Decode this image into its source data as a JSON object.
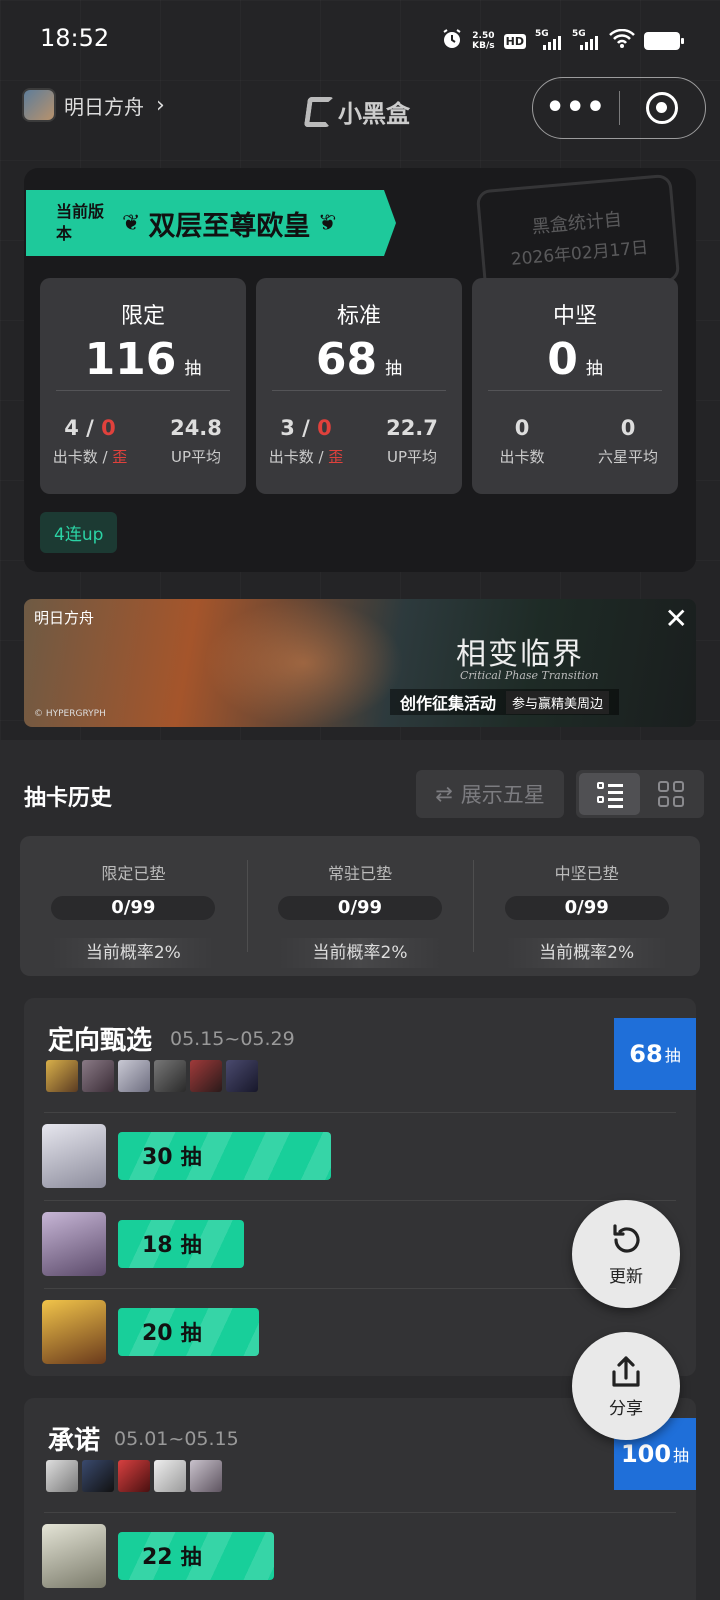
{
  "status_bar": {
    "time": "18:52",
    "speed_value": "2.50",
    "speed_unit": "KB/s",
    "hd": "HD",
    "net1": "5G",
    "net2": "5G"
  },
  "header": {
    "app_name": "明日方舟",
    "logo_text": "小黑盒"
  },
  "summary": {
    "rank_small": "当前版本",
    "rank_title": "双层至尊欧皇",
    "stamp_line1": "黑盒统计自",
    "stamp_line2": "2026年02月17日",
    "boxes": [
      {
        "name": "限定",
        "count": "116",
        "unit": "抽",
        "sub1_main": "4",
        "sub1_sep": " / ",
        "sub1_red": "0",
        "sub1_label": "出卡数 / ",
        "sub1_label_red": "歪",
        "sub2_value": "24.8",
        "sub2_label": "UP平均"
      },
      {
        "name": "标准",
        "count": "68",
        "unit": "抽",
        "sub1_main": "3",
        "sub1_sep": " / ",
        "sub1_red": "0",
        "sub1_label": "出卡数 / ",
        "sub1_label_red": "歪",
        "sub2_value": "22.7",
        "sub2_label": "UP平均"
      },
      {
        "name": "中坚",
        "count": "0",
        "unit": "抽",
        "sub1_main": "0",
        "sub1_sep": "",
        "sub1_red": "",
        "sub1_label": "出卡数",
        "sub1_label_red": "",
        "sub2_value": "0",
        "sub2_label": "六星平均"
      }
    ],
    "up_tag": "4连up"
  },
  "ad": {
    "brand": "明日方舟",
    "title": "相变临界",
    "subtitle": "Critical Phase Transition",
    "event": "创作征集活动",
    "reward": "参与赢精美周边",
    "copyright": "© HYPERGRYPH"
  },
  "history": {
    "title": "抽卡历史",
    "show_five_star": "展示五星",
    "pity": [
      {
        "label": "限定已垫",
        "value": "0/99",
        "rate": "当前概率2%"
      },
      {
        "label": "常驻已垫",
        "value": "0/99",
        "rate": "当前概率2%"
      },
      {
        "label": "中坚已垫",
        "value": "0/99",
        "rate": "当前概率2%"
      }
    ]
  },
  "pools": [
    {
      "name": "定向甄选",
      "date": "05.15~05.29",
      "total": "68",
      "unit": "抽",
      "rows": [
        {
          "pulls": "30",
          "unit": "抽",
          "fill": 0.71
        },
        {
          "pulls": "18",
          "unit": "抽",
          "fill": 0.42
        },
        {
          "pulls": "20",
          "unit": "抽",
          "fill": 0.47
        }
      ]
    },
    {
      "name": "承诺",
      "date": "05.01~05.15",
      "total": "100",
      "unit": "抽",
      "rows": [
        {
          "pulls": "22",
          "unit": "抽",
          "fill": 0.52
        }
      ]
    }
  ],
  "fab": {
    "refresh": "更新",
    "share": "分享"
  },
  "colors": {
    "accent": "#18cf9a",
    "total_badge": "#1f6fd9",
    "red": "#e0413c"
  },
  "icons": [
    "alarm-icon",
    "wifi-icon",
    "battery-icon",
    "chevron-right-icon",
    "more-icon",
    "target-icon",
    "swap-icon",
    "list-view-icon",
    "grid-view-icon",
    "refresh-icon",
    "share-icon",
    "close-icon"
  ]
}
